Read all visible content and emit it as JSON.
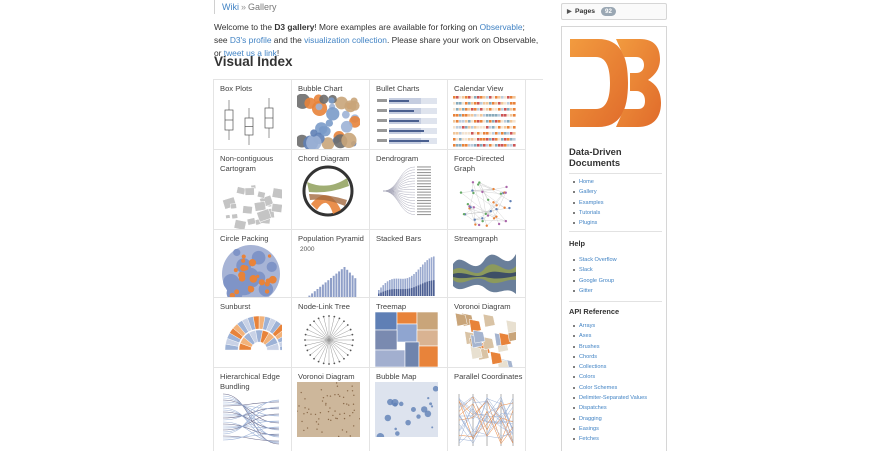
{
  "breadcrumb": {
    "wiki": "Wiki",
    "sep": "»",
    "current": "Gallery"
  },
  "intro": {
    "p1": "Welcome to the ",
    "b1": "D3 gallery",
    "p2": "! More examples are available for forking on ",
    "l1": "Observable",
    "p3": "; see ",
    "l2": "D3's profile",
    "p4": " and the ",
    "l3": "visualization collection",
    "p5": ". Please share your work on Observable, or ",
    "l4": "tweet us a link",
    "p6": "!"
  },
  "visual_index_title": "Visual Index",
  "gallery": [
    {
      "label": "Box Plots",
      "thumb": "box"
    },
    {
      "label": "Bubble Chart",
      "thumb": "bubble"
    },
    {
      "label": "Bullet Charts",
      "thumb": "bullet"
    },
    {
      "label": "Calendar View",
      "thumb": "calendar"
    },
    {
      "label": "Non-contiguous Cartogram",
      "thumb": "cartogram"
    },
    {
      "label": "Chord Diagram",
      "thumb": "chord"
    },
    {
      "label": "Dendrogram",
      "thumb": "dendrogram"
    },
    {
      "label": "Force-Directed Graph",
      "thumb": "force"
    },
    {
      "label": "Circle Packing",
      "thumb": "pack"
    },
    {
      "label": "Population Pyramid",
      "thumb": "pyramid",
      "sub": "2000"
    },
    {
      "label": "Stacked Bars",
      "thumb": "stacked"
    },
    {
      "label": "Streamgraph",
      "thumb": "stream"
    },
    {
      "label": "Sunburst",
      "thumb": "sunburst"
    },
    {
      "label": "Node-Link Tree",
      "thumb": "tree"
    },
    {
      "label": "Treemap",
      "thumb": "treemap"
    },
    {
      "label": "Voronoi Diagram",
      "thumb": "voronoi"
    },
    {
      "label": "Hierarchical Edge Bundling",
      "thumb": "bundling"
    },
    {
      "label": "Voronoi Diagram",
      "thumb": "voronoi2"
    },
    {
      "label": "Bubble Map",
      "thumb": "bubblemap"
    },
    {
      "label": "Parallel Coordinates",
      "thumb": "parallel"
    }
  ],
  "sidebar": {
    "pages_label": "Pages",
    "pages_count": "92",
    "logo_alt": "D3",
    "title": "Data-Driven Documents",
    "nav": [
      "Home",
      "Gallery",
      "Examples",
      "Tutorials",
      "Plugins"
    ],
    "help_title": "Help",
    "help": [
      "Stack Overflow",
      "Slack",
      "Google Group",
      "Gitter"
    ],
    "api_title": "API Reference",
    "api": [
      "Arrays",
      "Axes",
      "Brushes",
      "Chords",
      "Collections",
      "Colors",
      "Color Schemes",
      "Delimiter-Separated Values",
      "Dispatches",
      "Dragging",
      "Easings",
      "Fetches"
    ]
  },
  "colors": {
    "link": "#4183c4",
    "orange": "#e8833a",
    "blue": "#5f7fb5",
    "grey": "#aaaaaa"
  }
}
